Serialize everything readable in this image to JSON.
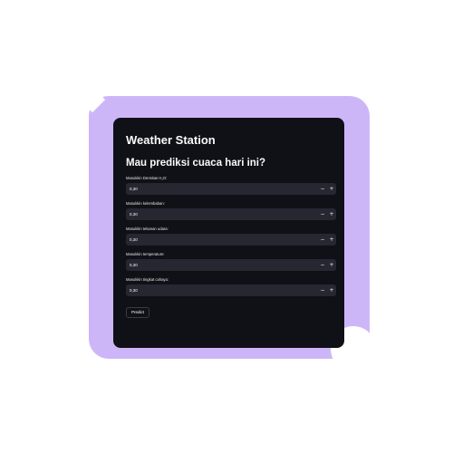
{
  "app": {
    "title": "Weather Station",
    "subtitle": "Mau prediksi cuaca hari ini?"
  },
  "fields": [
    {
      "label": "Masukkin Densitas H₂O:",
      "value": "0,30"
    },
    {
      "label": "Masukkin kelembaban:",
      "value": "0,30"
    },
    {
      "label": "Masukkin tekanan udara:",
      "value": "0,30"
    },
    {
      "label": "Masukkin temperature:",
      "value": "0,30"
    },
    {
      "label": "Masukkin tingkat cahaya:",
      "value": "0,30"
    }
  ],
  "stepper": {
    "minus": "−",
    "plus": "+"
  },
  "predict_label": "Predict",
  "colors": {
    "backdrop": "#cdb6f8",
    "app_bg": "#0f1117",
    "input_bg": "#262730",
    "text": "#fafafa"
  }
}
